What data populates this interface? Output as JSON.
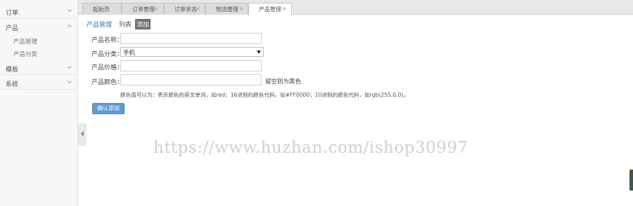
{
  "sidebar": {
    "groups": [
      {
        "label": "订单",
        "expanded": false
      },
      {
        "label": "产品",
        "expanded": true,
        "items": [
          "产品管理",
          "产品分类"
        ]
      },
      {
        "label": "模板",
        "expanded": false
      },
      {
        "label": "系统",
        "expanded": false
      }
    ]
  },
  "tabs": [
    {
      "label": "起始页",
      "closable": false
    },
    {
      "label": "订单管理",
      "closable": true
    },
    {
      "label": "订单状态",
      "closable": true
    },
    {
      "label": "物流管理",
      "closable": true
    },
    {
      "label": "产品管理",
      "closable": true,
      "active": true
    }
  ],
  "close_glyph": "×",
  "breadcrumb": {
    "link": "产品管理",
    "list": "列表",
    "add": "添加"
  },
  "form": {
    "name_label": "产品名称：",
    "category_label": "产品分类：",
    "category_value": "手机",
    "price_label": "产品价格：",
    "color_label": "产品颜色：",
    "color_hint": "留空则为黑色",
    "color_help": "颜色值可以为：表示颜色的英文单词，如red；16进制的颜色代码，如#FF0000；10进制的颜色代码，如rgb(255,0,0)。",
    "submit_label": "确认添加"
  },
  "watermark": "https://www.huzhan.com/ishop30997",
  "colors": {
    "accent": "#5b9bd5",
    "link": "#2a7ab7",
    "sidebar_bg": "#f7f7f7"
  }
}
